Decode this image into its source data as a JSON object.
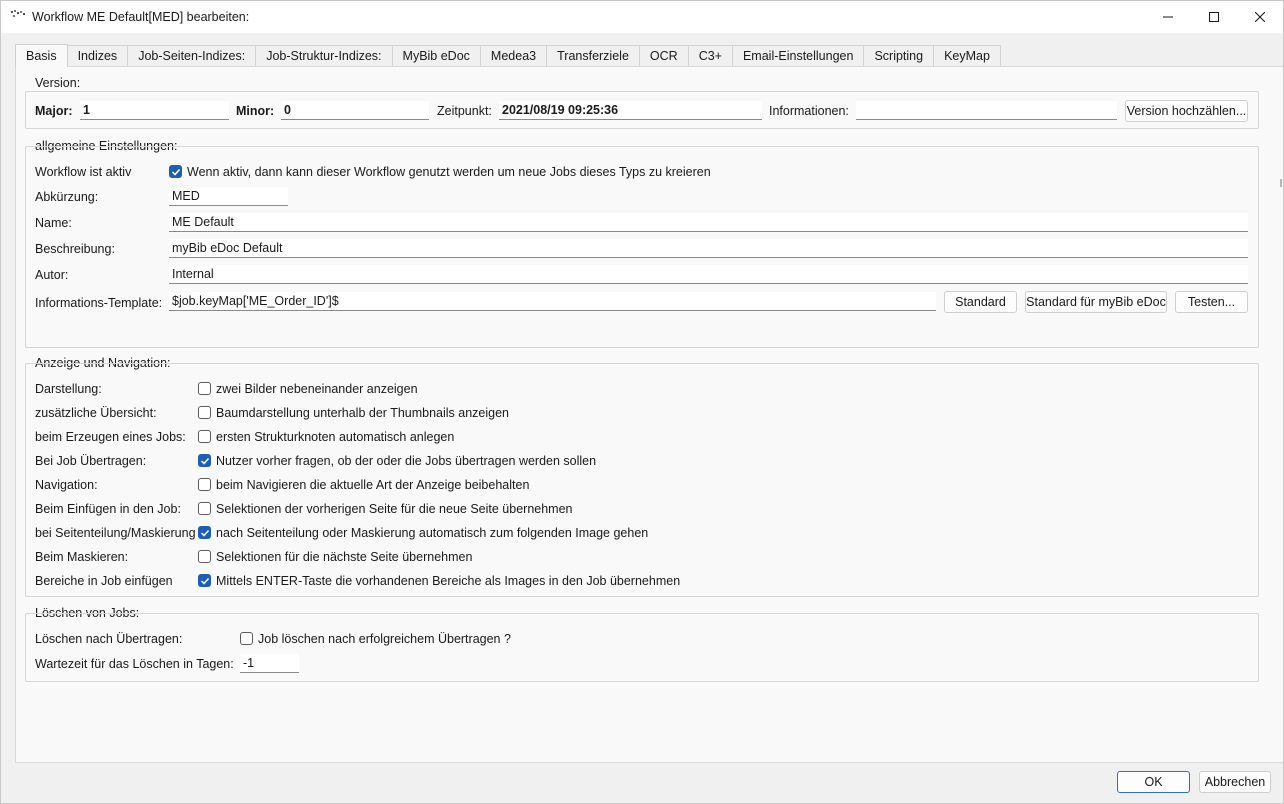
{
  "window": {
    "title": "Workflow ME Default[MED] bearbeiten:"
  },
  "tabs": [
    {
      "label": "Basis",
      "active": true
    },
    {
      "label": "Indizes"
    },
    {
      "label": "Job-Seiten-Indizes:"
    },
    {
      "label": "Job-Struktur-Indizes:"
    },
    {
      "label": "MyBib eDoc"
    },
    {
      "label": "Medea3"
    },
    {
      "label": "Transferziele"
    },
    {
      "label": "OCR"
    },
    {
      "label": "C3+"
    },
    {
      "label": "Email-Einstellungen"
    },
    {
      "label": "Scripting"
    },
    {
      "label": "KeyMap"
    }
  ],
  "version": {
    "title": "Version:",
    "major_label": "Major:",
    "major_value": "1",
    "minor_label": "Minor:",
    "minor_value": "0",
    "zeitpunkt_label": "Zeitpunkt:",
    "zeitpunkt_value": "2021/08/19 09:25:36",
    "info_label": "Informationen:",
    "info_value": "",
    "increment_button": "Version hochzählen..."
  },
  "general": {
    "title": "allgemeine Einstellungen:",
    "active_label": "Workflow ist aktiv",
    "active_checked": true,
    "active_text": "Wenn aktiv, dann kann dieser Workflow genutzt werden um neue Jobs dieses Typs zu kreieren",
    "abbr_label": "Abkürzung:",
    "abbr_value": "MED",
    "name_label": "Name:",
    "name_value": "ME Default",
    "desc_label": "Beschreibung:",
    "desc_value": "myBib eDoc Default",
    "author_label": "Autor:",
    "author_value": "Internal",
    "template_label": "Informations-Template:",
    "template_value": "$job.keyMap['ME_Order_ID']$",
    "btn_standard": "Standard",
    "btn_standard_mybib": "Standard für myBib eDoc",
    "btn_test": "Testen..."
  },
  "display": {
    "title": "Anzeige und Navigation:",
    "rows": [
      {
        "label": "Darstellung:",
        "text": "zwei Bilder nebeneinander anzeigen",
        "checked": false
      },
      {
        "label": "zusätzliche Übersicht:",
        "text": "Baumdarstellung unterhalb der Thumbnails anzeigen",
        "checked": false
      },
      {
        "label": "beim Erzeugen eines Jobs:",
        "text": "ersten Strukturknoten automatisch anlegen",
        "checked": false
      },
      {
        "label": "Bei Job Übertragen:",
        "text": "Nutzer vorher fragen, ob der oder die Jobs übertragen werden sollen",
        "checked": true
      },
      {
        "label": "Navigation:",
        "text": "beim Navigieren die aktuelle Art der Anzeige beibehalten",
        "checked": false
      },
      {
        "label": "Beim Einfügen in den Job:",
        "text": "Selektionen der vorherigen Seite für die neue Seite übernehmen",
        "checked": false
      },
      {
        "label": "bei Seitenteilung/Maskierung",
        "text": "nach Seitenteilung oder Maskierung automatisch zum folgenden Image gehen",
        "checked": true
      },
      {
        "label": "Beim Maskieren:",
        "text": "Selektionen  für die nächste Seite übernehmen",
        "checked": false
      },
      {
        "label": "Bereiche in Job einfügen",
        "text": "Mittels ENTER-Taste die vorhandenen Bereiche als Images in den Job übernehmen",
        "checked": true
      }
    ]
  },
  "deletion": {
    "title": "Löschen von Jobs:",
    "after_label": "Löschen nach Übertragen:",
    "after_text": "Job löschen nach erfolgreichem Übertragen ?",
    "after_checked": false,
    "wait_label": "Wartezeit für das Löschen in Tagen:",
    "wait_value": "-1"
  },
  "footer": {
    "ok": "OK",
    "cancel": "Abbrechen"
  }
}
